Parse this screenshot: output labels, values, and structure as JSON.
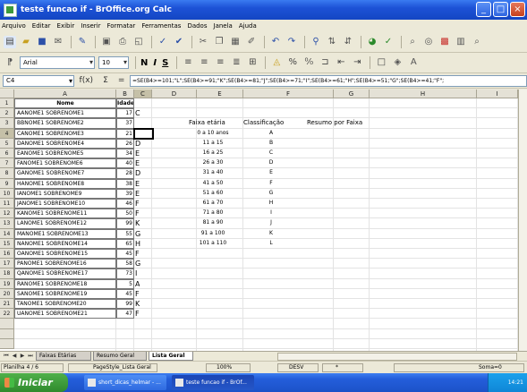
{
  "window": {
    "title": "teste funcao if - BrOffice.org Calc",
    "controls": [
      "_",
      "□",
      "×"
    ]
  },
  "menu": [
    "Arquivo",
    "Editar",
    "Exibir",
    "Inserir",
    "Formatar",
    "Ferramentas",
    "Dados",
    "Janela",
    "Ajuda"
  ],
  "toolbar2": {
    "font_name": "Arial",
    "font_size": "10",
    "bold": "N",
    "italic": "I",
    "underline": "S"
  },
  "formula": {
    "cell_ref": "C4",
    "icons": [
      "f(x)",
      "Σ",
      "="
    ],
    "content": "=SE(B4>=101;\"L\";SE(B4>=91;\"K\";SE(B4>=81;\"J\";SE(B4>=71;\"I\";SE(B4>=61;\"H\";SE(B4>=51;\"G\";SE(B4>=41;\"F\";"
  },
  "columns": [
    "A",
    "B",
    "C",
    "D",
    "E",
    "F",
    "G",
    "H",
    "I"
  ],
  "header_row": {
    "nome": "Nome",
    "idade": "Idade"
  },
  "rows": [
    {
      "n": "2",
      "name": "AANOME1 SOBRENOME1",
      "age": "17",
      "c": "C"
    },
    {
      "n": "3",
      "name": "BBNOME1 SOBRENOME2",
      "age": "37",
      "c": ""
    },
    {
      "n": "4",
      "name": "CANOME1 SOBRENOME3",
      "age": "21",
      "c": ""
    },
    {
      "n": "5",
      "name": "DANOME1 SOBRENOME4",
      "age": "26",
      "c": "D"
    },
    {
      "n": "6",
      "name": "EANOME1 SOBRENOME5",
      "age": "34",
      "c": "E"
    },
    {
      "n": "7",
      "name": "FANOME1 SOBRENOME6",
      "age": "40",
      "c": "E"
    },
    {
      "n": "8",
      "name": "GANOME1 SOBRENOME7",
      "age": "28",
      "c": "D"
    },
    {
      "n": "9",
      "name": "HANOME1 SOBRENOME8",
      "age": "38",
      "c": "E"
    },
    {
      "n": "10",
      "name": "IANOME1 SOBRENOME9",
      "age": "39",
      "c": "E"
    },
    {
      "n": "11",
      "name": "JANOME1 SOBRENOME10",
      "age": "46",
      "c": "F"
    },
    {
      "n": "12",
      "name": "KANOME1 SOBRENOME11",
      "age": "50",
      "c": "F"
    },
    {
      "n": "13",
      "name": "LANOME1 SOBRENOME12",
      "age": "99",
      "c": "K"
    },
    {
      "n": "14",
      "name": "MANOME1 SOBRENOME13",
      "age": "55",
      "c": "G"
    },
    {
      "n": "15",
      "name": "NANOME1 SOBRENOME14",
      "age": "65",
      "c": "H"
    },
    {
      "n": "16",
      "name": "OANOME1 SOBRENOME15",
      "age": "45",
      "c": "F"
    },
    {
      "n": "17",
      "name": "PANOME1 SOBRENOME16",
      "age": "58",
      "c": "G"
    },
    {
      "n": "18",
      "name": "QANOME1 SOBRENOME17",
      "age": "73",
      "c": "I"
    },
    {
      "n": "19",
      "name": "RANOME1 SOBRENOME18",
      "age": "5",
      "c": "A"
    },
    {
      "n": "20",
      "name": "SANOME1 SOBRENOME19",
      "age": "45",
      "c": "F"
    },
    {
      "n": "21",
      "name": "TANOME1 SOBRENOME20",
      "age": "99",
      "c": "K"
    },
    {
      "n": "22",
      "name": "UANOME1 SOBRENOME21",
      "age": "47",
      "c": "F"
    }
  ],
  "lookup": {
    "headers": [
      "Faixa etária",
      "Classificação",
      "Resumo por Faixa"
    ],
    "ranges": [
      {
        "faixa": "0 a 10 anos",
        "cls": "A"
      },
      {
        "faixa": "11 a 15",
        "cls": "B"
      },
      {
        "faixa": "16 a 25",
        "cls": "C"
      },
      {
        "faixa": "26 a 30",
        "cls": "D"
      },
      {
        "faixa": "31 a 40",
        "cls": "E"
      },
      {
        "faixa": "41 a 50",
        "cls": "F"
      },
      {
        "faixa": "51 a 60",
        "cls": "G"
      },
      {
        "faixa": "61 a 70",
        "cls": "H"
      },
      {
        "faixa": "71 a 80",
        "cls": "I"
      },
      {
        "faixa": "81 a 90",
        "cls": "J"
      },
      {
        "faixa": "91 a 100",
        "cls": "K"
      },
      {
        "faixa": "101 a 110",
        "cls": "L"
      }
    ]
  },
  "tabs": [
    "Faixas Etárias",
    "Resumo Geral",
    "Lista Geral"
  ],
  "status": {
    "sheet": "Planilha 4 / 6",
    "style": "PageStyle_Lista Geral",
    "zoom": "100%",
    "mode": "DESV",
    "sum": "Soma=0"
  },
  "taskbar": {
    "start": "Iniciar",
    "items": [
      "short_dicas_helmar - ...",
      "teste funcao if - BrOf..."
    ],
    "clock": "14:21"
  }
}
